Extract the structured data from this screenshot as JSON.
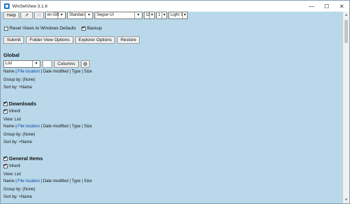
{
  "window": {
    "title": "WinSetView 3.1.6"
  },
  "toolbar": {
    "help_label": "Help",
    "pin_icon": "pin-icon",
    "dots_icon": "dots-icon",
    "lang_value": "en-GB",
    "mode_value": "Standard",
    "font_value": "Segoe UI",
    "size_value": "11",
    "spacing_value": "1",
    "theme_value": "Light 1"
  },
  "options": {
    "reset_label": "Reset Views to Windows Defaults",
    "reset_checked": false,
    "backup_label": "Backup",
    "backup_checked": true
  },
  "actions": {
    "submit": "Submit",
    "folder_view_options": "Folder View Options",
    "explorer_options": "Explorer Options",
    "restore": "Restore"
  },
  "global": {
    "title": "Global",
    "view_value": "List",
    "columns_label": "Columns",
    "columns": {
      "name": "Name",
      "file_location": "File location",
      "date_modified": "Date modified",
      "type": "Type",
      "size": "Size"
    },
    "group_by": "Group by: (None)",
    "sort_by": "Sort by: +Name"
  },
  "downloads": {
    "title": "Downloads",
    "inherit_label": "Inherit",
    "view": "View: List",
    "columns": {
      "name": "Name",
      "file_location": "File location",
      "date_modified": "Date modified",
      "type": "Type",
      "size": "Size"
    },
    "group_by": "Group by: (None)",
    "sort_by": "Sort by: +Name"
  },
  "general_items": {
    "title": "General Items",
    "inherit_label": "Inherit",
    "view": "View: List",
    "columns": {
      "name": "Name",
      "file_location": "File location",
      "date_modified": "Date modified",
      "type": "Type",
      "size": "Size"
    },
    "group_by": "Group by: (None)",
    "sort_by": "Sort by: +Name"
  },
  "colors": {
    "background": "#b9d9ea",
    "link": "#0645ad"
  }
}
